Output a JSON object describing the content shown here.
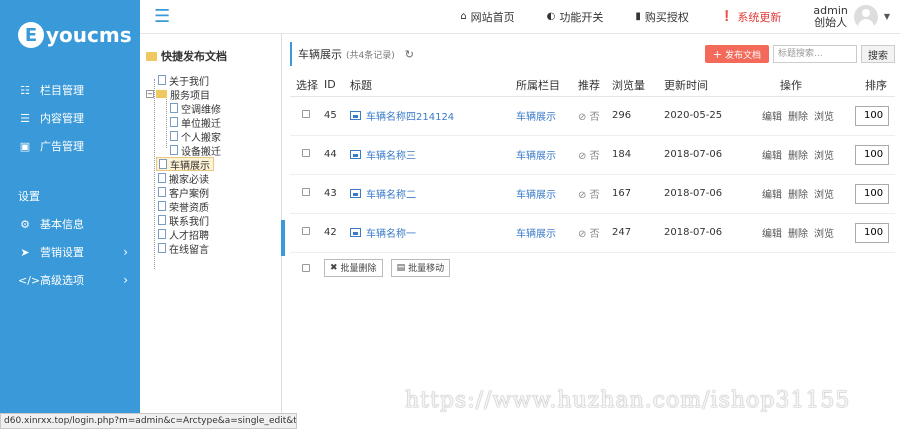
{
  "brand": {
    "logo_letter": "E",
    "logo_text": "youcms"
  },
  "sidebar": {
    "items": [
      {
        "label": "栏目管理",
        "icon": "sitemap-icon"
      },
      {
        "label": "内容管理",
        "icon": "list-icon"
      },
      {
        "label": "广告管理",
        "icon": "image-icon"
      }
    ],
    "section_label": "设置",
    "settings": [
      {
        "label": "基本信息",
        "icon": "gear-icon"
      },
      {
        "label": "营销设置",
        "icon": "send-icon"
      },
      {
        "label": "高级选项",
        "icon": "code-icon"
      }
    ]
  },
  "topbar": {
    "home": "网站首页",
    "toggle": "功能开关",
    "buy": "购买授权",
    "update": "系统更新",
    "username": "admin",
    "role": "创始人"
  },
  "tree": {
    "title": "快捷发布文档",
    "nodes": [
      "关于我们",
      "服务项目",
      "空调维修",
      "单位搬迁",
      "个人搬家",
      "设备搬迁",
      "车辆展示",
      "搬家必读",
      "客户案例",
      "荣誉资质",
      "联系我们",
      "人才招聘",
      "在线留言"
    ]
  },
  "main": {
    "title": "车辆展示",
    "count": "(共4条记录)",
    "publish_label": "发布文档",
    "search_placeholder": "标题搜索...",
    "search_label": "搜索",
    "headers": [
      "选择",
      "ID",
      "标题",
      "所属栏目",
      "推荐",
      "浏览量",
      "更新时间",
      "操作",
      "排序"
    ],
    "rows": [
      {
        "id": "45",
        "title": "车辆名称四214124",
        "column": "车辆展示",
        "rec": "否",
        "views": "296",
        "date": "2020-05-25",
        "edit": "编辑",
        "del": "删除",
        "view": "浏览",
        "sort": "100"
      },
      {
        "id": "44",
        "title": "车辆名称三",
        "column": "车辆展示",
        "rec": "否",
        "views": "184",
        "date": "2018-07-06",
        "edit": "编辑",
        "del": "删除",
        "view": "浏览",
        "sort": "100"
      },
      {
        "id": "43",
        "title": "车辆名称二",
        "column": "车辆展示",
        "rec": "否",
        "views": "167",
        "date": "2018-07-06",
        "edit": "编辑",
        "del": "删除",
        "view": "浏览",
        "sort": "100"
      },
      {
        "id": "42",
        "title": "车辆名称一",
        "column": "车辆展示",
        "rec": "否",
        "views": "247",
        "date": "2018-07-06",
        "edit": "编辑",
        "del": "删除",
        "view": "浏览",
        "sort": "100"
      }
    ],
    "batch_delete": "批量删除",
    "batch_move": "批量移动"
  },
  "watermark": "https://www.huzhan.com/ishop31155",
  "status_url": "d60.xinrxx.top/login.php?m=admin&c=Arctype&a=single_edit&typeid..."
}
